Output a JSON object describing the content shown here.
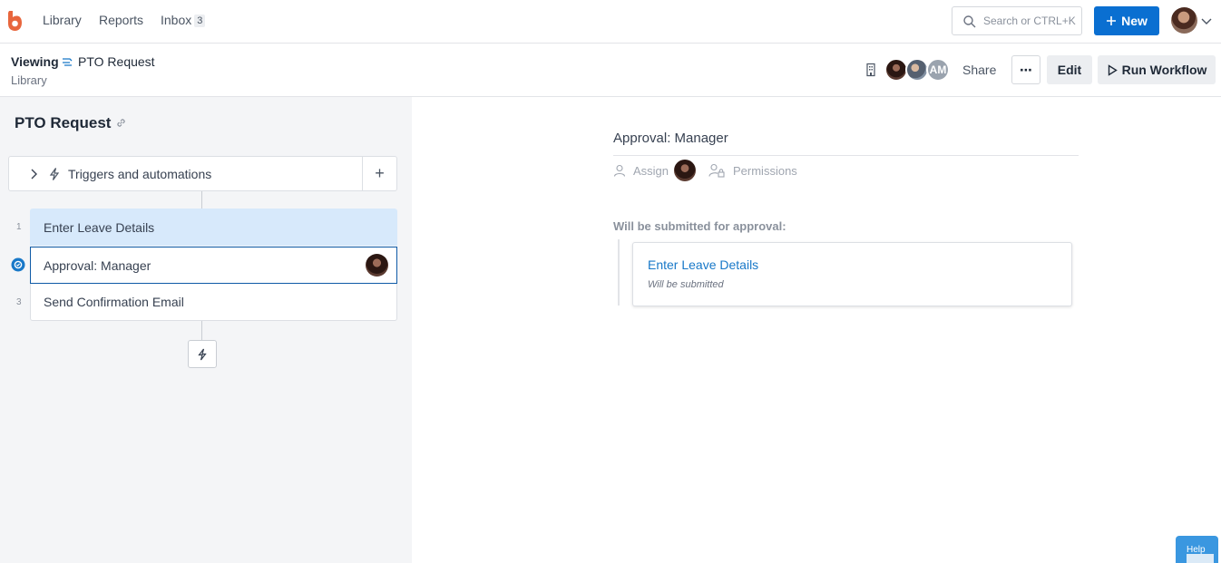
{
  "nav": {
    "items": [
      {
        "label": "Library"
      },
      {
        "label": "Reports"
      },
      {
        "label": "Inbox",
        "badge": "3"
      }
    ],
    "search": {
      "placeholder": "Search or CTRL+K"
    },
    "new_button": "New",
    "brand_color": "#0a6fd1",
    "logo_color": "#e8663d"
  },
  "header": {
    "viewing_label": "Viewing",
    "document_title": "PTO Request",
    "breadcrumb": "Library",
    "avatars": [
      {
        "initials": ""
      },
      {
        "initials": ""
      },
      {
        "initials": "AM"
      }
    ],
    "share_label": "Share",
    "more_label": "⋯",
    "edit_label": "Edit",
    "run_label": "Run Workflow"
  },
  "sidebar": {
    "workflow_title": "PTO Request",
    "triggers_label": "Triggers and automations",
    "add_symbol": "+",
    "steps": [
      {
        "number": "1",
        "label": "Enter Leave Details"
      },
      {
        "number": "",
        "label": "Approval: Manager"
      },
      {
        "number": "3",
        "label": "Send Confirmation Email"
      }
    ],
    "selected_color": "#d7e9fb"
  },
  "detail": {
    "title": "Approval: Manager",
    "assign_label": "Assign",
    "permissions_label": "Permissions",
    "submitted_heading": "Will be submitted for approval:",
    "card": {
      "title": "Enter Leave Details",
      "subtitle": "Will be submitted"
    }
  },
  "help": {
    "label": "Help"
  }
}
